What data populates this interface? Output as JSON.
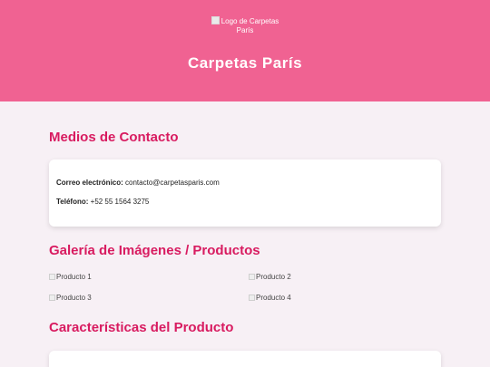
{
  "header": {
    "logo_alt": "Logo de Carpetas París",
    "site_title": "Carpetas París"
  },
  "contact": {
    "title": "Medios de Contacto",
    "email_label": "Correo electrónico:",
    "email_value": "contacto@carpetasparis.com",
    "phone_label": "Teléfono:",
    "phone_value": "+52 55 1564 3275"
  },
  "gallery": {
    "title": "Galería de Imágenes / Productos",
    "items": [
      {
        "alt": "Producto 1"
      },
      {
        "alt": "Producto 2"
      },
      {
        "alt": "Producto 3"
      },
      {
        "alt": "Producto 4"
      }
    ]
  },
  "features": {
    "title": "Características del Producto"
  },
  "colors": {
    "header_bg": "#f06292",
    "accent_title": "#d81b60",
    "page_bg": "#f7f0f5",
    "card_bg": "#ffffff"
  },
  "icons": {
    "broken_image": "broken-image-icon"
  }
}
